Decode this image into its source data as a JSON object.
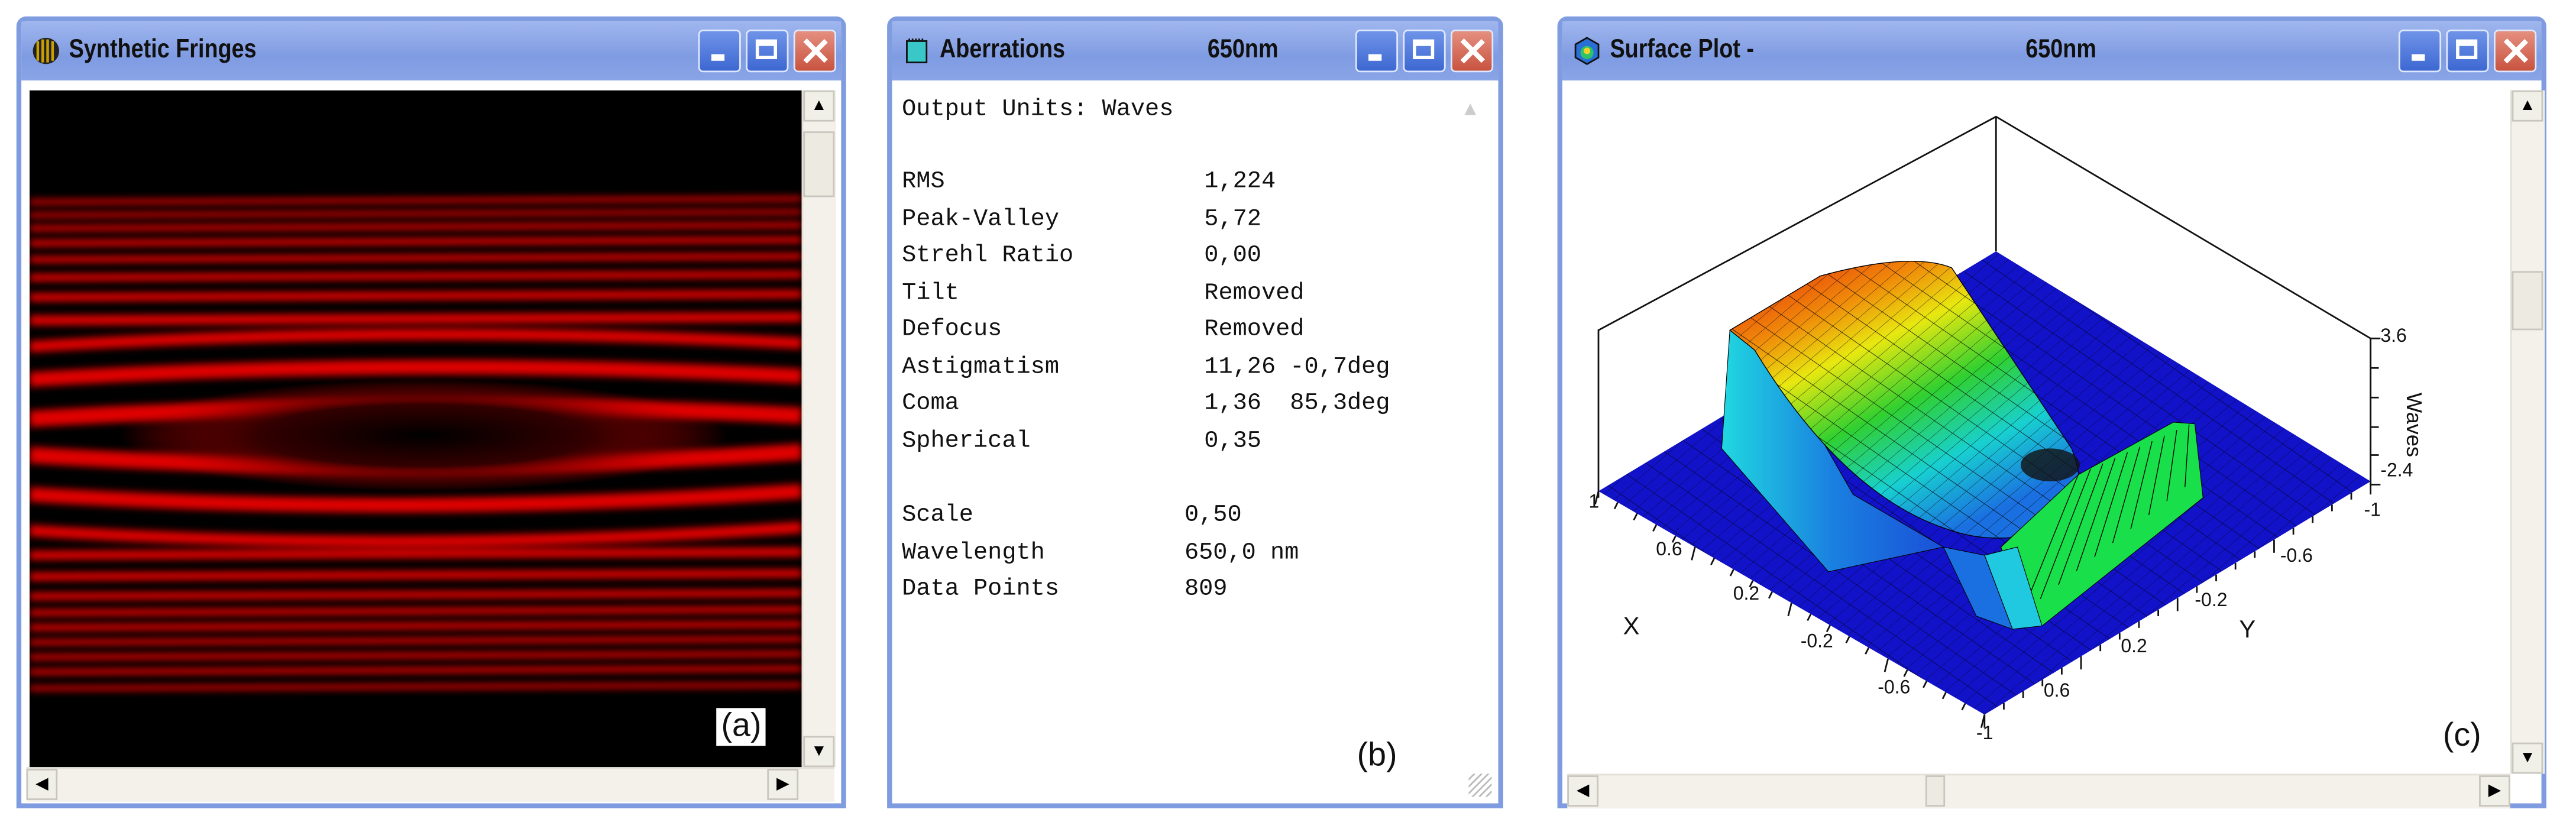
{
  "windows": {
    "fringes": {
      "title": "Synthetic Fringes",
      "icon": "fringe-icon",
      "panel_label": "(a)"
    },
    "aberrations": {
      "title": "Aberrations",
      "wavelength_title": "650nm",
      "icon": "notepad-icon",
      "output_units": "Output Units: Waves",
      "rows": [
        {
          "label": "RMS",
          "value": "1,224"
        },
        {
          "label": "Peak-Valley",
          "value": "5,72"
        },
        {
          "label": "Strehl Ratio",
          "value": "0,00"
        },
        {
          "label": "Tilt",
          "value": "Removed"
        },
        {
          "label": "Defocus",
          "value": "Removed"
        },
        {
          "label": "Astigmatism",
          "value": "11,26 -0,7deg"
        },
        {
          "label": "Coma",
          "value": "1,36  85,3deg"
        },
        {
          "label": "Spherical",
          "value": "0,35"
        }
      ],
      "rows2": [
        {
          "label": "Scale",
          "value": "0,50"
        },
        {
          "label": "Wavelength",
          "value": "650,0 nm"
        },
        {
          "label": "Data Points",
          "value": "809"
        }
      ],
      "panel_label": "(b)"
    },
    "surface": {
      "title": "Surface Plot -",
      "wavelength_title": "650nm",
      "icon": "surface-plot-icon",
      "panel_label": "(c)"
    }
  },
  "chart_data": {
    "type": "surface3d",
    "xlabel": "X",
    "ylabel": "Y",
    "zlabel": "Waves",
    "x_ticks": [
      "1",
      "0.6",
      "0.2",
      "-0.2",
      "-0.6",
      "-1"
    ],
    "y_ticks": [
      "-1",
      "-0.6",
      "-0.2",
      "0.2",
      "0.6"
    ],
    "z_ticks": [
      "3.6",
      "-2.4"
    ],
    "zlim": [
      -2.4,
      3.6
    ]
  },
  "colors": {
    "titlebar": "#8aa5e6",
    "fringe": "#e00000",
    "plot_base": "#1010c8"
  }
}
